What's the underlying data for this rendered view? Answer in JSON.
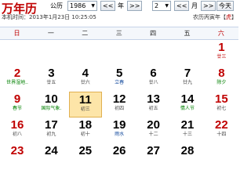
{
  "logo": "万年历",
  "controls": {
    "year": "1986",
    "year_arrow": "▼",
    "calendar_label": "公历",
    "month": "2",
    "month_arrow": "▼",
    "prev_year": "<<",
    "year_unit": "年",
    "next_year": ">>",
    "prev_month": "<<",
    "month_unit": "月",
    "next_month": ">>",
    "today_button": "今天"
  },
  "local_time": "本机时间：2013年1月23日 10:25:05",
  "lunar_year": {
    "text": "农历丙寅年【",
    "zodiac": "虎",
    "close": "】"
  },
  "weekdays": [
    "日",
    "一",
    "二",
    "三",
    "四",
    "五",
    "六"
  ],
  "rows": [
    [
      {
        "d": "",
        "l": ""
      },
      {
        "d": "",
        "l": ""
      },
      {
        "d": "",
        "l": ""
      },
      {
        "d": "",
        "l": ""
      },
      {
        "d": "",
        "l": ""
      },
      {
        "d": "",
        "l": ""
      },
      {
        "d": "1",
        "l": "廿三",
        "dc": "red",
        "lc": "red"
      }
    ],
    [
      {
        "d": "2",
        "l": "世界湿地..",
        "dc": "red",
        "lc": "green"
      },
      {
        "d": "3",
        "l": "廿五"
      },
      {
        "d": "4",
        "l": "廿六"
      },
      {
        "d": "5",
        "l": "立春",
        "lc": "blue"
      },
      {
        "d": "6",
        "l": "廿八"
      },
      {
        "d": "7",
        "l": "廿九"
      },
      {
        "d": "8",
        "l": "除夕",
        "dc": "red",
        "lc": "green"
      }
    ],
    [
      {
        "d": "9",
        "l": "春节",
        "dc": "red",
        "lc": "green"
      },
      {
        "d": "10",
        "l": "国际气象.",
        "lc": "green"
      },
      {
        "d": "11",
        "l": "初三",
        "today": true
      },
      {
        "d": "12",
        "l": "初四"
      },
      {
        "d": "13",
        "l": "初五"
      },
      {
        "d": "14",
        "l": "情人节",
        "lc": "green"
      },
      {
        "d": "15",
        "l": "初七",
        "dc": "red"
      }
    ],
    [
      {
        "d": "16",
        "l": "初八",
        "dc": "red"
      },
      {
        "d": "17",
        "l": "初九"
      },
      {
        "d": "18",
        "l": "初十"
      },
      {
        "d": "19",
        "l": "雨水",
        "lc": "blue"
      },
      {
        "d": "20",
        "l": "十二"
      },
      {
        "d": "21",
        "l": "十三"
      },
      {
        "d": "22",
        "l": "十四",
        "dc": "red"
      }
    ],
    [
      {
        "d": "23",
        "l": "",
        "dc": "red"
      },
      {
        "d": "24",
        "l": ""
      },
      {
        "d": "25",
        "l": ""
      },
      {
        "d": "26",
        "l": ""
      },
      {
        "d": "27",
        "l": ""
      },
      {
        "d": "28",
        "l": ""
      },
      {
        "d": "",
        "l": ""
      }
    ]
  ]
}
